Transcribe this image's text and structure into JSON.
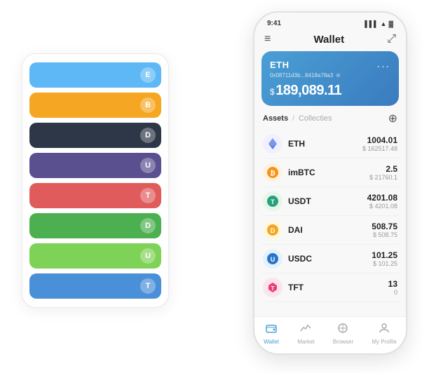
{
  "scene": {
    "background": "#ffffff"
  },
  "cardStack": {
    "rows": [
      {
        "color": "blue",
        "iconText": "E"
      },
      {
        "color": "orange",
        "iconText": "B"
      },
      {
        "color": "dark",
        "iconText": "D"
      },
      {
        "color": "purple",
        "iconText": "U"
      },
      {
        "color": "red",
        "iconText": "T"
      },
      {
        "color": "green",
        "iconText": "D"
      },
      {
        "color": "light-green",
        "iconText": "U"
      },
      {
        "color": "steel-blue",
        "iconText": "T"
      }
    ]
  },
  "phone": {
    "statusBar": {
      "time": "9:41",
      "signal": "▌▌▌",
      "wifi": "▲",
      "battery": "▓"
    },
    "header": {
      "menuIcon": "≡",
      "title": "Wallet",
      "expandIcon": "⤢"
    },
    "ethCard": {
      "label": "ETH",
      "dotsMenu": "...",
      "address": "0x08711d3b...8418a78a3",
      "copyIcon": "⊕",
      "balancePrefix": "$",
      "balance": "189,089.11"
    },
    "assetsSection": {
      "tabActive": "Assets",
      "tabDivider": "/",
      "tabInactive": "Collecties",
      "addIcon": "⊕",
      "assets": [
        {
          "name": "ETH",
          "amount": "1004.01",
          "usd": "$ 162517.48",
          "iconColor": "#627eea",
          "iconText": "♦"
        },
        {
          "name": "imBTC",
          "amount": "2.5",
          "usd": "$ 21760.1",
          "iconColor": "#f7931a",
          "iconText": "₿"
        },
        {
          "name": "USDT",
          "amount": "4201.08",
          "usd": "$ 4201.08",
          "iconColor": "#26a17b",
          "iconText": "T"
        },
        {
          "name": "DAI",
          "amount": "508.75",
          "usd": "$ 508.75",
          "iconColor": "#f5a623",
          "iconText": "D"
        },
        {
          "name": "USDC",
          "amount": "101.25",
          "usd": "$ 101.25",
          "iconColor": "#2775ca",
          "iconText": "U"
        },
        {
          "name": "TFT",
          "amount": "13",
          "usd": "0",
          "iconColor": "#e91e63",
          "iconText": "T"
        }
      ]
    },
    "bottomNav": [
      {
        "label": "Wallet",
        "icon": "◎",
        "active": true
      },
      {
        "label": "Market",
        "icon": "↑",
        "active": false
      },
      {
        "label": "Browser",
        "icon": "⊙",
        "active": false
      },
      {
        "label": "My Profile",
        "icon": "◷",
        "active": false
      }
    ]
  }
}
